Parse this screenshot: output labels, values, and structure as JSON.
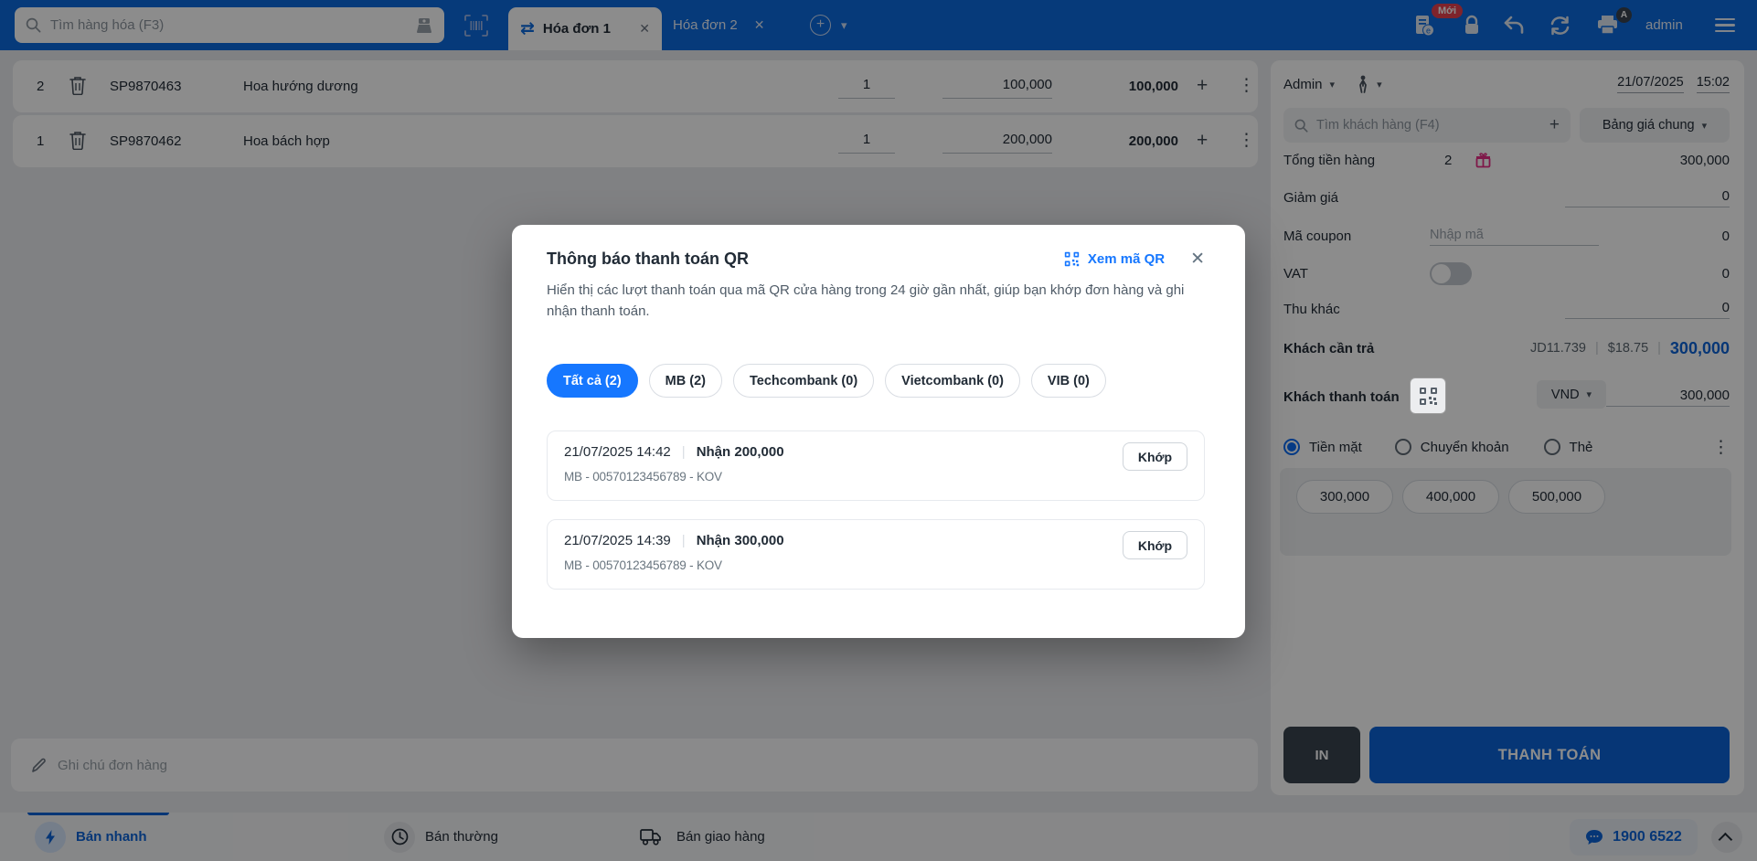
{
  "header": {
    "search_placeholder": "Tìm hàng hóa (F3)",
    "tabs": [
      {
        "label": "Hóa đơn 1",
        "active": true
      },
      {
        "label": "Hóa đơn 2",
        "active": false
      }
    ],
    "badge_new": "Mới",
    "printer_badge": "A",
    "user": "admin"
  },
  "order_items": [
    {
      "index": "2",
      "code": "SP9870463",
      "name": "Hoa hướng dương",
      "qty": "1",
      "price": "100,000",
      "total": "100,000"
    },
    {
      "index": "1",
      "code": "SP9870462",
      "name": "Hoa bách hợp",
      "qty": "1",
      "price": "200,000",
      "total": "200,000"
    }
  ],
  "note_placeholder": "Ghi chú đơn hàng",
  "sidebar": {
    "seller": "Admin",
    "date": "21/07/2025",
    "time": "15:02",
    "customer_search_placeholder": "Tìm khách hàng (F4)",
    "price_table": "Bảng giá chung",
    "total_label": "Tổng tiền hàng",
    "total_qty": "2",
    "total_value": "300,000",
    "discount_label": "Giảm giá",
    "discount_value": "0",
    "coupon_label": "Mã coupon",
    "coupon_placeholder": "Nhập mã",
    "coupon_value": "0",
    "vat_label": "VAT",
    "vat_value": "0",
    "other_label": "Thu khác",
    "other_value": "0",
    "due_label": "Khách cần trả",
    "due_jd": "JD11.739",
    "due_usd": "$18.75",
    "due_value": "300,000",
    "paid_label": "Khách thanh toán",
    "currency": "VND",
    "paid_value": "300,000",
    "methods": [
      "Tiền mặt",
      "Chuyển khoản",
      "Thẻ"
    ],
    "quick_amounts": [
      "300,000",
      "400,000",
      "500,000"
    ],
    "print_button": "IN",
    "pay_button": "THANH TOÁN"
  },
  "modal": {
    "title": "Thông báo thanh toán QR",
    "view_qr": "Xem mã QR",
    "description": "Hiển thị các lượt thanh toán qua mã QR cửa hàng trong 24 giờ gần nhất, giúp bạn khớp đơn hàng và ghi nhận thanh toán.",
    "filters": [
      {
        "label": "Tất cả (2)",
        "active": true
      },
      {
        "label": "MB (2)",
        "active": false
      },
      {
        "label": "Techcombank (0)",
        "active": false
      },
      {
        "label": "Vietcombank (0)",
        "active": false
      },
      {
        "label": "VIB (0)",
        "active": false
      }
    ],
    "payments": [
      {
        "time": "21/07/2025 14:42",
        "amount": "Nhận 200,000",
        "account": "MB - 00570123456789 - KOV",
        "action": "Khớp"
      },
      {
        "time": "21/07/2025 14:39",
        "amount": "Nhận 300,000",
        "account": "MB - 00570123456789 - KOV",
        "action": "Khớp"
      }
    ]
  },
  "footer": {
    "modes": [
      {
        "label": "Bán nhanh",
        "active": true
      },
      {
        "label": "Bán thường",
        "active": false
      },
      {
        "label": "Bán giao hàng",
        "active": false
      }
    ],
    "hotline": "1900 6522"
  },
  "colors": {
    "primary_blue": "#0b6adf",
    "modal_accent_blue": "#1677ff",
    "pay_button_blue": "#0b63d8",
    "dark_button": "#39444f",
    "badge_red": "#e8414f",
    "gift_pink": "#e72c86",
    "overlay": "rgba(0,0,0,0.45)"
  }
}
